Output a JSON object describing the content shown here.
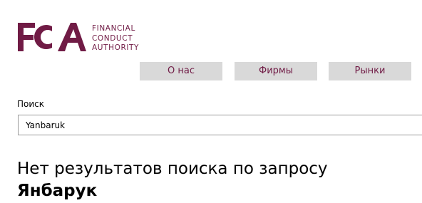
{
  "brand": {
    "logo_letters": "FCA",
    "logo_lines": [
      "FINANCIAL",
      "CONDUCT",
      "AUTHORITY"
    ],
    "color": "#701b45"
  },
  "nav": {
    "items": [
      {
        "label": "О нас"
      },
      {
        "label": "Фирмы"
      },
      {
        "label": "Рынки"
      }
    ],
    "background": "#d9d9d9"
  },
  "search": {
    "label": "Поиск",
    "value": "Yanbaruk"
  },
  "results": {
    "message": "Нет результатов поиска по запросу",
    "query": "Янбарук"
  }
}
